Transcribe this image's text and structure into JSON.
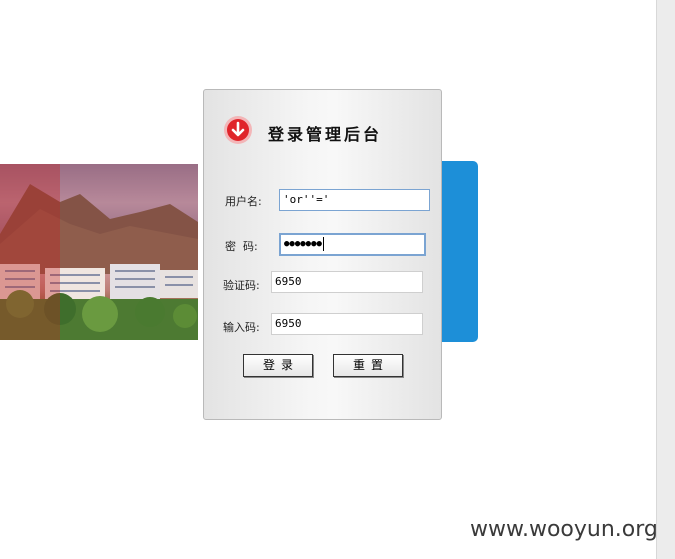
{
  "login": {
    "title": "登录管理后台",
    "username_label": "用户名:",
    "username_value": "'or''='",
    "password_label": "密  码:",
    "password_value": "●●●●●●●",
    "captcha_label": "验证码:",
    "captcha_value": "6950",
    "input_code_label": "输入码:",
    "input_code_value": "6950",
    "login_button": "登录",
    "reset_button": "重置"
  },
  "watermark": "www.wooyun.org",
  "colors": {
    "accent_blue": "#1d8fd8",
    "logo_red": "#e0242a",
    "field_focus_border": "#7ba4d2"
  },
  "icons": {
    "logo": "down-arrow-circle-icon"
  }
}
